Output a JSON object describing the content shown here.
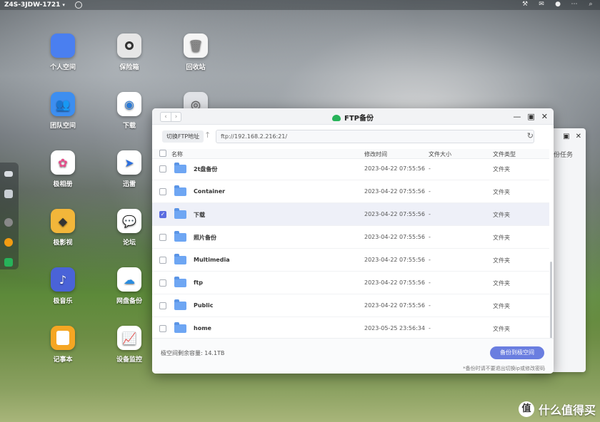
{
  "topbar": {
    "device_name": "Z4S-3JDW-1721",
    "right_icons": [
      "tool-icon",
      "mail-icon",
      "user-icon",
      "more-icon",
      "search-icon"
    ]
  },
  "desktop": {
    "apps": [
      {
        "label": "个人空间",
        "icon": "folder-icon",
        "color": "#4a7ff0"
      },
      {
        "label": "保险箱",
        "icon": "safe-icon",
        "color": "#e6e6e6"
      },
      {
        "label": "回收站",
        "icon": "trash-icon",
        "color": "#f5f5f5"
      },
      {
        "label": "团队空间",
        "icon": "team-folder-icon",
        "color": "#3d8ef0"
      },
      {
        "label": "下载",
        "icon": "download-icon",
        "color": "#ffffff"
      },
      {
        "label": "",
        "icon": "app-icon",
        "color": "#e0e2e6"
      },
      {
        "label": "极相册",
        "icon": "photos-icon",
        "color": "#ffffff"
      },
      {
        "label": "迅雷",
        "icon": "thunder-icon",
        "color": "#ffffff"
      },
      {
        "label": "极影视",
        "icon": "video-icon",
        "color": "#f2b63a"
      },
      {
        "label": "论坛",
        "icon": "forum-icon",
        "color": "#ffffff"
      },
      {
        "label": "极音乐",
        "icon": "music-icon",
        "color": "#4a63d8"
      },
      {
        "label": "网盘备份",
        "icon": "cloud-backup-icon",
        "color": "#ffffff"
      },
      {
        "label": "记事本",
        "icon": "notepad-icon",
        "color": "#f5a623"
      },
      {
        "label": "设备监控",
        "icon": "monitor-icon",
        "color": "#ffffff"
      }
    ]
  },
  "bg_window": {
    "button": "备份任务"
  },
  "window": {
    "title": "FTP备份",
    "switch_label": "切换FTP地址",
    "address": "ftp://192.168.2.216:21/",
    "headers": {
      "name": "名称",
      "modified": "修改时间",
      "size": "文件大小",
      "type": "文件类型"
    },
    "rows": [
      {
        "name": "2t盘备份",
        "modified": "2023-04-22 07:55:56",
        "size": "-",
        "type": "文件夹",
        "checked": false
      },
      {
        "name": "Container",
        "modified": "2023-04-22 07:55:56",
        "size": "-",
        "type": "文件夹",
        "checked": false
      },
      {
        "name": "下载",
        "modified": "2023-04-22 07:55:56",
        "size": "-",
        "type": "文件夹",
        "checked": true
      },
      {
        "name": "照片备份",
        "modified": "2023-04-22 07:55:56",
        "size": "-",
        "type": "文件夹",
        "checked": false
      },
      {
        "name": "Multimedia",
        "modified": "2023-04-22 07:55:56",
        "size": "-",
        "type": "文件夹",
        "checked": false
      },
      {
        "name": "ftp",
        "modified": "2023-04-22 07:55:56",
        "size": "-",
        "type": "文件夹",
        "checked": false
      },
      {
        "name": "Public",
        "modified": "2023-04-22 07:55:56",
        "size": "-",
        "type": "文件夹",
        "checked": false
      },
      {
        "name": "home",
        "modified": "2023-05-25 23:56:34",
        "size": "-",
        "type": "文件夹",
        "checked": false
      }
    ],
    "space_label": "极空间剩余容量: 14.1TB",
    "backup_button": "备份到极空间",
    "note": "*备份时请不要退出切换ip或修改密码"
  },
  "watermark": {
    "badge": "值",
    "text": "什么值得买"
  }
}
